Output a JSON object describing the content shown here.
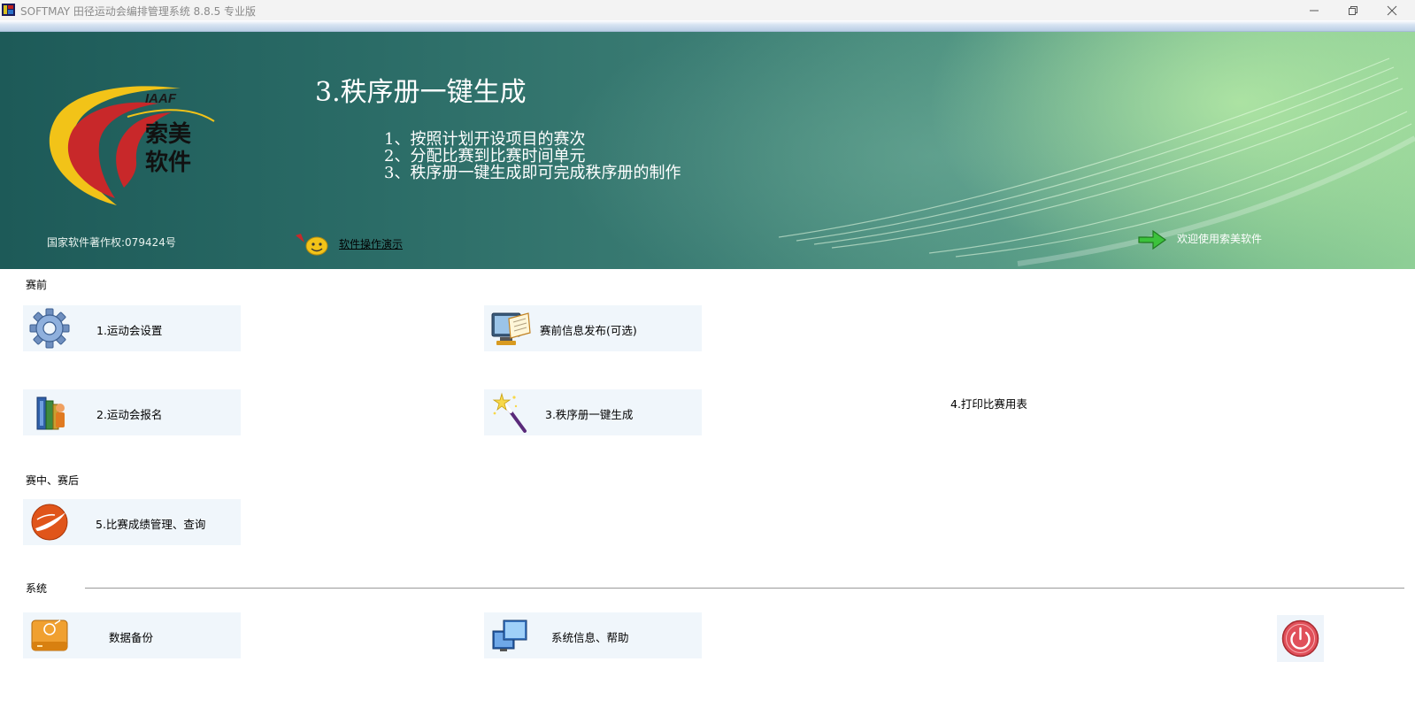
{
  "window": {
    "title": "SOFTMAY 田径运动会编排管理系统 8.8.5  专业版"
  },
  "banner": {
    "copyright": "国家软件著作权:079424号",
    "demo_link": "软件操作演示",
    "title": "3.秩序册一键生成",
    "steps": [
      "1、按照计划开设项目的赛次",
      "2、分配比赛到比赛时间单元",
      "3、秩序册一键生成即可完成秩序册的制作"
    ],
    "welcome": "欢迎使用索美软件",
    "logo_text": [
      "IAAF",
      "索美",
      "软件"
    ]
  },
  "sections": {
    "pre": "赛前",
    "during": "赛中、赛后",
    "system": "系统"
  },
  "tiles": {
    "meet_settings": "1.运动会设置",
    "pre_info": "赛前信息发布(可选)",
    "registration": "2.运动会报名",
    "order_book": "3.秩序册一键生成",
    "print_forms": "4.打印比赛用表",
    "results": "5.比赛成绩管理、查询",
    "backup": "数据备份",
    "sysinfo": "系统信息、帮助"
  },
  "icons": [
    "gear-icon",
    "monitor-document-icon",
    "books-person-icon",
    "magic-wand-icon",
    "swoosh-ball-icon",
    "drive-icon",
    "windows-icon",
    "power-icon",
    "arrow-right-icon",
    "smiley-icon"
  ]
}
